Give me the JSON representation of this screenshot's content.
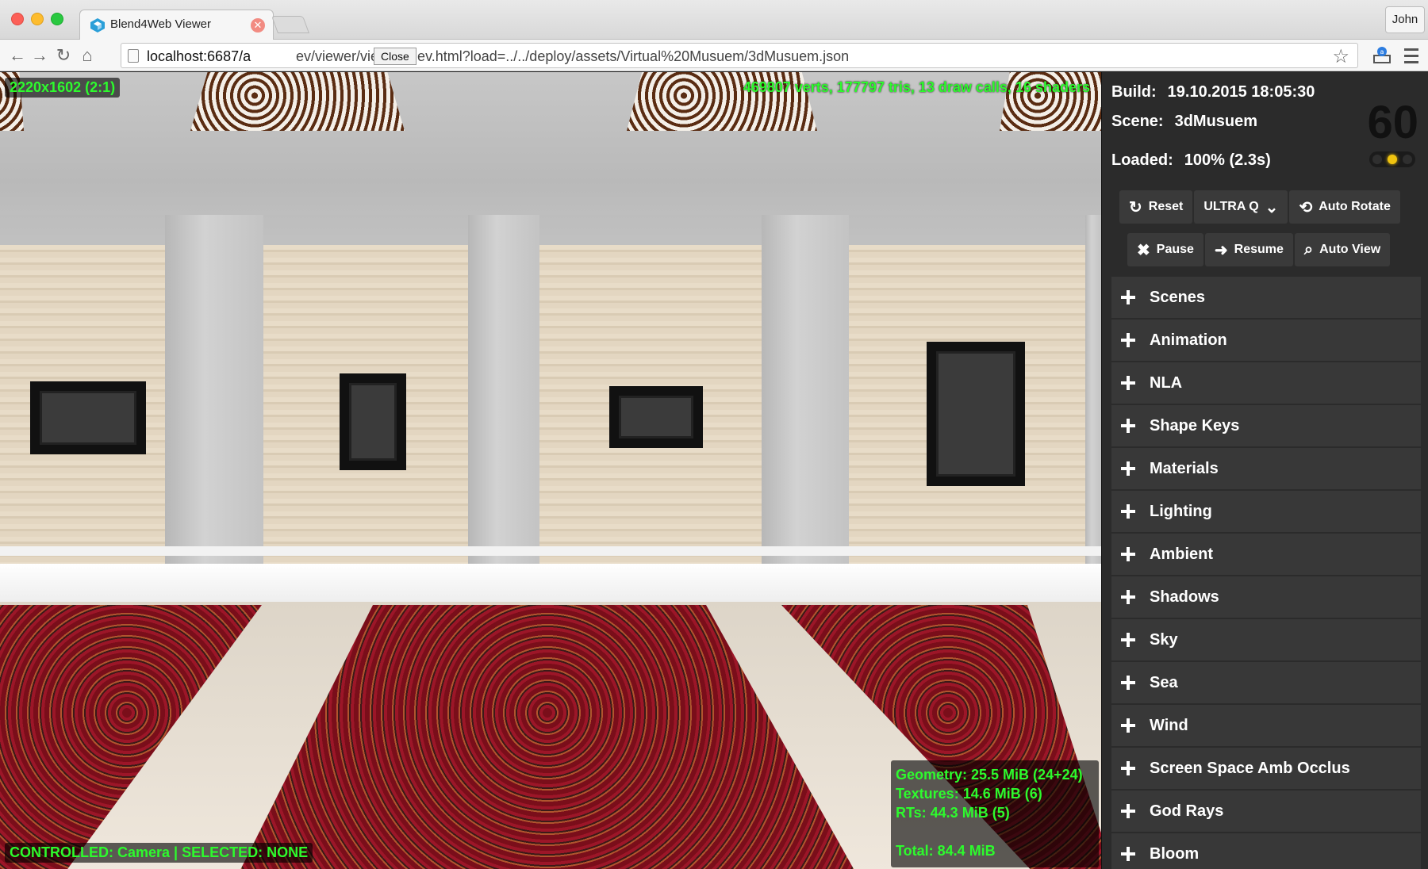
{
  "window": {
    "tab_title": "Blend4Web Viewer",
    "profile_name": "John",
    "tooltip": "Close"
  },
  "address_bar": {
    "host": "localhost:6687/a",
    "path": "ev/viewer/viewer_dev.html?load=../../deploy/assets/Virtual%20Musuem/3dMusuem.json"
  },
  "viewport": {
    "resolution": "2220x1602 (2:1)",
    "render_stats": "469807 verts, 177797 tris, 13 draw calls, 16 shaders",
    "memory": {
      "geometry": "Geometry: 25.5 MiB (24+24)",
      "textures": "Textures: 14.6 MiB (6)",
      "rts": "RTs: 44.3 MiB (5)",
      "total": "Total: 84.4 MiB"
    },
    "controlled": "CONTROLLED: Camera | SELECTED: NONE"
  },
  "info": {
    "build_label": "Build:",
    "build_value": "19.10.2015 18:05:30",
    "scene_label": "Scene:",
    "scene_value": "3dMusuem",
    "loaded_label": "Loaded:",
    "loaded_value": "100% (2.3s)",
    "fps": "60"
  },
  "buttons": {
    "reset": "Reset",
    "quality": "ULTRA Q",
    "auto_rotate": "Auto Rotate",
    "pause": "Pause",
    "resume": "Resume",
    "auto_view": "Auto View"
  },
  "sections": [
    "Scenes",
    "Animation",
    "NLA",
    "Shape Keys",
    "Materials",
    "Lighting",
    "Ambient",
    "Shadows",
    "Sky",
    "Sea",
    "Wind",
    "Screen Space Amb Occlus",
    "God Rays",
    "Bloom"
  ],
  "colors": {
    "hud_text": "#2dfb2d",
    "panel_bg": "#2b2b2b",
    "section_bg": "#383838",
    "led_on": "#f1c40f"
  }
}
